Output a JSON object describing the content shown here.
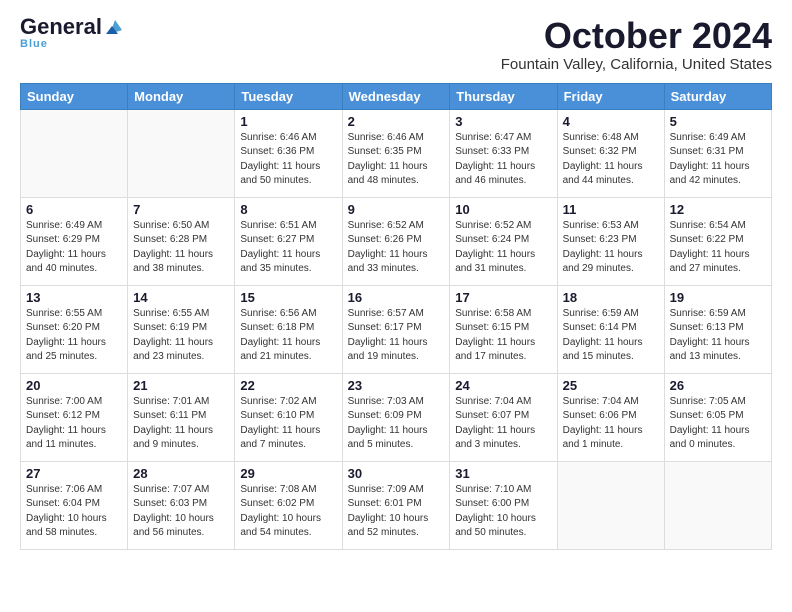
{
  "header": {
    "logo": {
      "general": "General",
      "blue": "Blue"
    },
    "title": "October 2024",
    "subtitle": "Fountain Valley, California, United States"
  },
  "days_of_week": [
    "Sunday",
    "Monday",
    "Tuesday",
    "Wednesday",
    "Thursday",
    "Friday",
    "Saturday"
  ],
  "weeks": [
    [
      {
        "day": "",
        "sunrise": "",
        "sunset": "",
        "daylight": ""
      },
      {
        "day": "",
        "sunrise": "",
        "sunset": "",
        "daylight": ""
      },
      {
        "day": "1",
        "sunrise": "Sunrise: 6:46 AM",
        "sunset": "Sunset: 6:36 PM",
        "daylight": "Daylight: 11 hours and 50 minutes."
      },
      {
        "day": "2",
        "sunrise": "Sunrise: 6:46 AM",
        "sunset": "Sunset: 6:35 PM",
        "daylight": "Daylight: 11 hours and 48 minutes."
      },
      {
        "day": "3",
        "sunrise": "Sunrise: 6:47 AM",
        "sunset": "Sunset: 6:33 PM",
        "daylight": "Daylight: 11 hours and 46 minutes."
      },
      {
        "day": "4",
        "sunrise": "Sunrise: 6:48 AM",
        "sunset": "Sunset: 6:32 PM",
        "daylight": "Daylight: 11 hours and 44 minutes."
      },
      {
        "day": "5",
        "sunrise": "Sunrise: 6:49 AM",
        "sunset": "Sunset: 6:31 PM",
        "daylight": "Daylight: 11 hours and 42 minutes."
      }
    ],
    [
      {
        "day": "6",
        "sunrise": "Sunrise: 6:49 AM",
        "sunset": "Sunset: 6:29 PM",
        "daylight": "Daylight: 11 hours and 40 minutes."
      },
      {
        "day": "7",
        "sunrise": "Sunrise: 6:50 AM",
        "sunset": "Sunset: 6:28 PM",
        "daylight": "Daylight: 11 hours and 38 minutes."
      },
      {
        "day": "8",
        "sunrise": "Sunrise: 6:51 AM",
        "sunset": "Sunset: 6:27 PM",
        "daylight": "Daylight: 11 hours and 35 minutes."
      },
      {
        "day": "9",
        "sunrise": "Sunrise: 6:52 AM",
        "sunset": "Sunset: 6:26 PM",
        "daylight": "Daylight: 11 hours and 33 minutes."
      },
      {
        "day": "10",
        "sunrise": "Sunrise: 6:52 AM",
        "sunset": "Sunset: 6:24 PM",
        "daylight": "Daylight: 11 hours and 31 minutes."
      },
      {
        "day": "11",
        "sunrise": "Sunrise: 6:53 AM",
        "sunset": "Sunset: 6:23 PM",
        "daylight": "Daylight: 11 hours and 29 minutes."
      },
      {
        "day": "12",
        "sunrise": "Sunrise: 6:54 AM",
        "sunset": "Sunset: 6:22 PM",
        "daylight": "Daylight: 11 hours and 27 minutes."
      }
    ],
    [
      {
        "day": "13",
        "sunrise": "Sunrise: 6:55 AM",
        "sunset": "Sunset: 6:20 PM",
        "daylight": "Daylight: 11 hours and 25 minutes."
      },
      {
        "day": "14",
        "sunrise": "Sunrise: 6:55 AM",
        "sunset": "Sunset: 6:19 PM",
        "daylight": "Daylight: 11 hours and 23 minutes."
      },
      {
        "day": "15",
        "sunrise": "Sunrise: 6:56 AM",
        "sunset": "Sunset: 6:18 PM",
        "daylight": "Daylight: 11 hours and 21 minutes."
      },
      {
        "day": "16",
        "sunrise": "Sunrise: 6:57 AM",
        "sunset": "Sunset: 6:17 PM",
        "daylight": "Daylight: 11 hours and 19 minutes."
      },
      {
        "day": "17",
        "sunrise": "Sunrise: 6:58 AM",
        "sunset": "Sunset: 6:15 PM",
        "daylight": "Daylight: 11 hours and 17 minutes."
      },
      {
        "day": "18",
        "sunrise": "Sunrise: 6:59 AM",
        "sunset": "Sunset: 6:14 PM",
        "daylight": "Daylight: 11 hours and 15 minutes."
      },
      {
        "day": "19",
        "sunrise": "Sunrise: 6:59 AM",
        "sunset": "Sunset: 6:13 PM",
        "daylight": "Daylight: 11 hours and 13 minutes."
      }
    ],
    [
      {
        "day": "20",
        "sunrise": "Sunrise: 7:00 AM",
        "sunset": "Sunset: 6:12 PM",
        "daylight": "Daylight: 11 hours and 11 minutes."
      },
      {
        "day": "21",
        "sunrise": "Sunrise: 7:01 AM",
        "sunset": "Sunset: 6:11 PM",
        "daylight": "Daylight: 11 hours and 9 minutes."
      },
      {
        "day": "22",
        "sunrise": "Sunrise: 7:02 AM",
        "sunset": "Sunset: 6:10 PM",
        "daylight": "Daylight: 11 hours and 7 minutes."
      },
      {
        "day": "23",
        "sunrise": "Sunrise: 7:03 AM",
        "sunset": "Sunset: 6:09 PM",
        "daylight": "Daylight: 11 hours and 5 minutes."
      },
      {
        "day": "24",
        "sunrise": "Sunrise: 7:04 AM",
        "sunset": "Sunset: 6:07 PM",
        "daylight": "Daylight: 11 hours and 3 minutes."
      },
      {
        "day": "25",
        "sunrise": "Sunrise: 7:04 AM",
        "sunset": "Sunset: 6:06 PM",
        "daylight": "Daylight: 11 hours and 1 minute."
      },
      {
        "day": "26",
        "sunrise": "Sunrise: 7:05 AM",
        "sunset": "Sunset: 6:05 PM",
        "daylight": "Daylight: 11 hours and 0 minutes."
      }
    ],
    [
      {
        "day": "27",
        "sunrise": "Sunrise: 7:06 AM",
        "sunset": "Sunset: 6:04 PM",
        "daylight": "Daylight: 10 hours and 58 minutes."
      },
      {
        "day": "28",
        "sunrise": "Sunrise: 7:07 AM",
        "sunset": "Sunset: 6:03 PM",
        "daylight": "Daylight: 10 hours and 56 minutes."
      },
      {
        "day": "29",
        "sunrise": "Sunrise: 7:08 AM",
        "sunset": "Sunset: 6:02 PM",
        "daylight": "Daylight: 10 hours and 54 minutes."
      },
      {
        "day": "30",
        "sunrise": "Sunrise: 7:09 AM",
        "sunset": "Sunset: 6:01 PM",
        "daylight": "Daylight: 10 hours and 52 minutes."
      },
      {
        "day": "31",
        "sunrise": "Sunrise: 7:10 AM",
        "sunset": "Sunset: 6:00 PM",
        "daylight": "Daylight: 10 hours and 50 minutes."
      },
      {
        "day": "",
        "sunrise": "",
        "sunset": "",
        "daylight": ""
      },
      {
        "day": "",
        "sunrise": "",
        "sunset": "",
        "daylight": ""
      }
    ]
  ]
}
